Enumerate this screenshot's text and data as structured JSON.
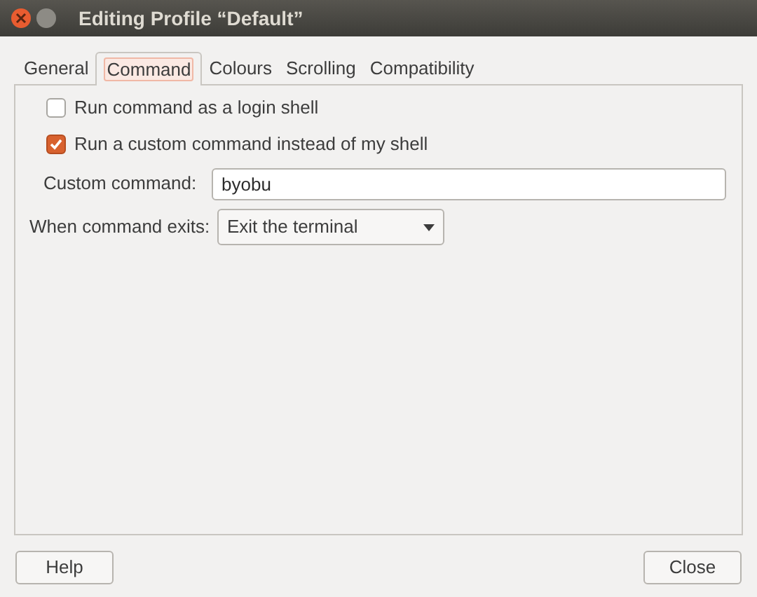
{
  "window": {
    "title": "Editing Profile “Default”"
  },
  "tabs": [
    {
      "label": "General",
      "selected": false
    },
    {
      "label": "Command",
      "selected": true
    },
    {
      "label": "Colours",
      "selected": false
    },
    {
      "label": "Scrolling",
      "selected": false
    },
    {
      "label": "Compatibility",
      "selected": false
    }
  ],
  "options": [
    {
      "label": "Run command as a login shell",
      "checked": false
    },
    {
      "label": "Run a custom command instead of my shell",
      "checked": true
    }
  ],
  "custom_command": {
    "label": "Custom command:",
    "value": "byobu"
  },
  "exit_action": {
    "label": "When command exits:",
    "value": "Exit the terminal"
  },
  "buttons": [
    {
      "label": "Help"
    },
    {
      "label": "Close"
    }
  ]
}
